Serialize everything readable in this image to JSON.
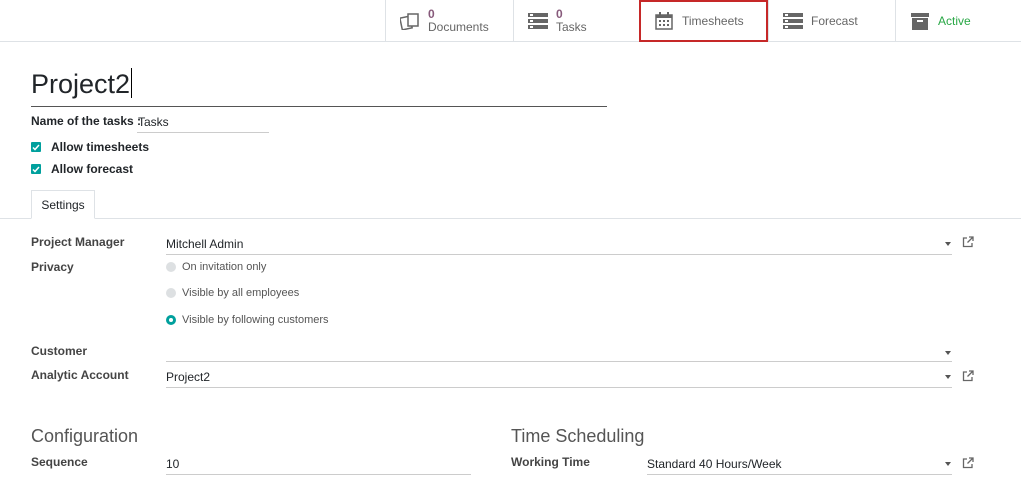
{
  "smart_buttons": {
    "documents": {
      "count": "0",
      "label": "Documents"
    },
    "tasks": {
      "count": "0",
      "label": "Tasks"
    },
    "timesheets": {
      "label": "Timesheets"
    },
    "forecast": {
      "label": "Forecast"
    },
    "active": {
      "label": "Active"
    }
  },
  "title": "Project2",
  "tasks_name": {
    "label": "Name of the tasks :",
    "value": "Tasks"
  },
  "checkboxes": [
    {
      "label": "Allow timesheets",
      "checked": true
    },
    {
      "label": "Allow forecast",
      "checked": true
    }
  ],
  "tabs": [
    {
      "label": "Settings"
    }
  ],
  "fields": {
    "project_manager": {
      "label": "Project Manager",
      "value": "Mitchell Admin"
    },
    "privacy": {
      "label": "Privacy",
      "options": [
        {
          "label": "On invitation only",
          "selected": false
        },
        {
          "label": "Visible by all employees",
          "selected": false
        },
        {
          "label": "Visible by following customers",
          "selected": true
        }
      ]
    },
    "customer": {
      "label": "Customer",
      "value": ""
    },
    "analytic_account": {
      "label": "Analytic Account",
      "value": "Project2"
    }
  },
  "configuration": {
    "title": "Configuration",
    "sequence": {
      "label": "Sequence",
      "value": "10"
    }
  },
  "time_scheduling": {
    "title": "Time Scheduling",
    "working_time": {
      "label": "Working Time",
      "value": "Standard 40 Hours/Week"
    }
  },
  "colors": {
    "accent": "#00a09d",
    "count": "#875a7b",
    "active": "#28a745",
    "highlight": "#c62828"
  }
}
